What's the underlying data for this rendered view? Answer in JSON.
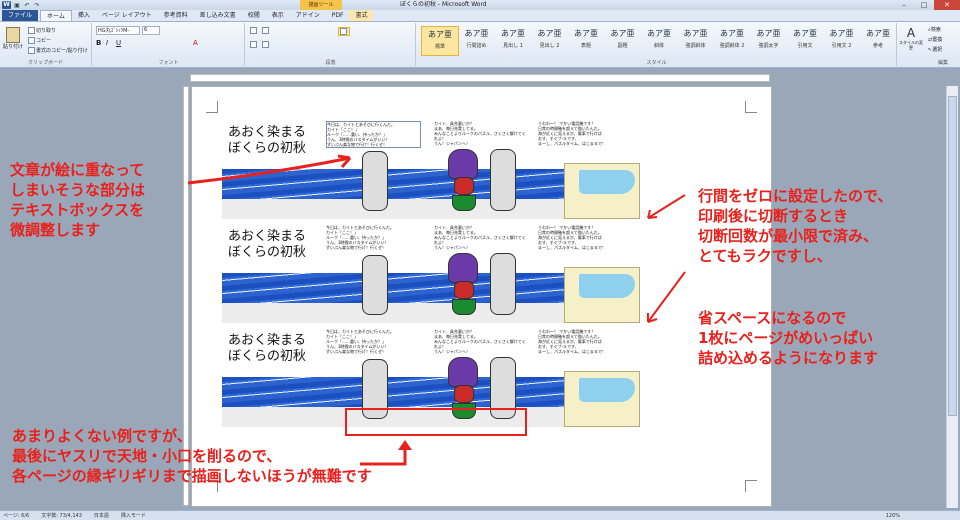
{
  "window": {
    "app_icon": "W",
    "title": "ぼくらの初秋  -  Microsoft Word",
    "context_tool": "描画ツール",
    "controls": [
      "–",
      "□",
      "✕"
    ]
  },
  "qat_icons": [
    "save-icon",
    "undo-icon",
    "redo-icon"
  ],
  "tabs": [
    "ファイル",
    "ホーム",
    "挿入",
    "ページ レイアウト",
    "参考資料",
    "差し込み文書",
    "校閲",
    "表示",
    "アドイン",
    "PDF",
    "書式"
  ],
  "ribbon": {
    "clipboard": {
      "paste": "貼り付け",
      "cut": "切り取り",
      "copy": "コピー",
      "format_painter": "書式のコピー/貼り付け",
      "label": "クリップボード"
    },
    "font": {
      "name": "HG丸ｺﾞｼｯｸM-",
      "size": "6",
      "label": "フォント"
    },
    "paragraph": {
      "label": "段落"
    },
    "styles": {
      "items": [
        {
          "preview": "あア亜",
          "label": "標準"
        },
        {
          "preview": "あア亜",
          "label": "行間詰め"
        },
        {
          "preview": "あア亜",
          "label": "見出し 1"
        },
        {
          "preview": "あア亜",
          "label": "見出し 2"
        },
        {
          "preview": "あア亜",
          "label": "表題"
        },
        {
          "preview": "あア亜",
          "label": "副題"
        },
        {
          "preview": "あア亜",
          "label": "斜体"
        },
        {
          "preview": "あア亜",
          "label": "強調斜体"
        },
        {
          "preview": "あア亜",
          "label": "強調斜体 2"
        },
        {
          "preview": "あア亜",
          "label": "強調太字"
        },
        {
          "preview": "あア亜",
          "label": "引用文"
        },
        {
          "preview": "あア亜",
          "label": "引用文 2"
        },
        {
          "preview": "あア亜",
          "label": "参考"
        }
      ],
      "change": "スタイルの変更",
      "label": "スタイル"
    },
    "editing": {
      "find": "検索",
      "replace": "置換",
      "select": "選択",
      "label": "編集"
    }
  },
  "strips": [
    {
      "title_line1": "あおく染まる",
      "title_line2": "ぼくらの初秋",
      "text1": "今日は、カイトとあそびに行くんだ。\nカイト「ここ！」\nルーク「……重い、持ったか？」\nうん、3時間のバスタイムがいい！\nずいぶん楽な物で行け！行くぜ！",
      "text2": "カイト、具合悪いか？\nまあ、毎日充実してる。\nみんなことよりルークのパズル、さくさく解けてくれよ！\nうん！ジャパンへ！",
      "text3": "うわわ～！ でかい電話機です！\n日常の時間軸を超えて描いたんだ。\n海が近くに見えるか、電車で行けば\nおす、すぐブ-ルです、\nまーし、パズルタイム、はじまるで！"
    },
    {
      "title_line1": "あおく染まる",
      "title_line2": "ぼくらの初秋",
      "text1": "今日は、カイトとあそびに行くんだ。\nカイト「ここ！」\nルーク「……重い、持ったか？」\nうん、3時間のバスタイムがいい！\nずいぶん楽な物で行け！行くぜ！",
      "text2": "カイト、具合悪いか？\nまあ、毎日充実してる。\nみんなことよりルークのパズル、さくさく解けてくれよ！\nうん！ジャパンへ！",
      "text3": "うわわ～！ でかい電話機です！\n日常の時間軸を超えて描いたんだ。\n海が近くに見えるか、電車で行けば\nおす、すぐブ-ルです、\nまーし、パズルタイム、はじまるで！"
    },
    {
      "title_line1": "あおく染まる",
      "title_line2": "ぼくらの初秋",
      "text1": "今日は、カイトとあそびに行くんだ。\nカイト「ここ！」\nルーク「……重い、持ったか？」\nうん、3時間のバスタイムがいい！\nずいぶん楽な物で行け！行くぜ！",
      "text2": "カイト、具合悪いか？\nまあ、毎日充実してる。\nみんなことよりルークのパズル、さくさく解けてくれよ！\nうん！ジャパンへ！",
      "text3": "うわわ～！ でかい電話機です！\n日常の時間軸を超えて描いたんだ。\n海が近くに見えるか、電車で行けば\nおす、すぐブ-ルです、\nまーし、パズルタイム、はじまるで！"
    }
  ],
  "annotations": {
    "left": [
      "文章が絵に重なって",
      "しまいそうな部分は",
      "テキストボックスを",
      "微調整します"
    ],
    "right": [
      "行間をゼロに設定したので、",
      "印刷後に切断するとき",
      "切断回数が最小限で済み、",
      "とてもラクですし、"
    ],
    "right2": [
      "省スペースになるので",
      "1枚にページがめいっぱい",
      "詰め込めるようになります"
    ],
    "bottom": [
      "あまりよくない例ですが、",
      "最後にヤスリで天地・小口を削るので、",
      "各ページの縁ギリギリまで描画しないほうが無難です"
    ]
  },
  "status": {
    "page": "ページ: 6/6",
    "words": "文字数: 73/4,143",
    "lang": "日本語",
    "mode": "挿入モード",
    "zoom": "120%"
  },
  "colors": {
    "annotation": "#e8211c",
    "sea": "#2f6ad8",
    "ribbon": "#dde7f3"
  }
}
